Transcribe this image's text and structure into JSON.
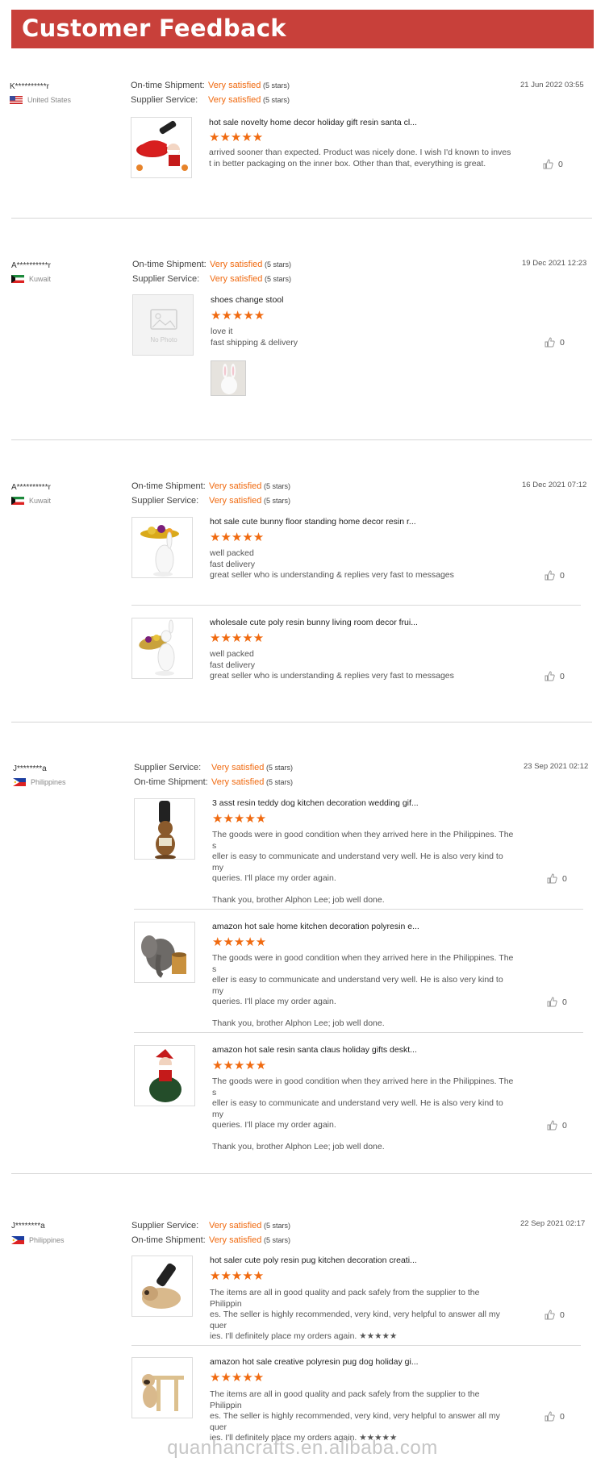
{
  "header": {
    "title": "Customer Feedback"
  },
  "like_count": "0",
  "reviews": [
    {
      "user": "K**********r",
      "country": "United States",
      "date": "21 Jun 2022 03:55",
      "ratings": [
        {
          "label": "On-time Shipment:",
          "value": "Very satisfied",
          "stars": "(5 stars)"
        },
        {
          "label": "Supplier Service:",
          "value": "Very satisfied",
          "stars": "(5 stars)"
        }
      ],
      "items": [
        {
          "title": "hot sale novelty home decor holiday gift resin santa cl...",
          "stars": "★★★★★",
          "lines": [
            "arrived sooner than expected.  Product was nicely done.  I wish I'd known to inves",
            "t in better packaging on the inner box.  Other than that, everything is great."
          ]
        }
      ]
    },
    {
      "user": "A**********r",
      "country": "Kuwait",
      "date": "19 Dec 2021 12:23",
      "ratings": [
        {
          "label": "On-time Shipment:",
          "value": "Very satisfied",
          "stars": "(5 stars)"
        },
        {
          "label": "Supplier Service:",
          "value": "Very satisfied",
          "stars": "(5 stars)"
        }
      ],
      "items": [
        {
          "title": "shoes change stool",
          "stars": "★★★★★",
          "no_photo": "No Photo",
          "lines": [
            "love it",
            "fast shipping & delivery"
          ]
        }
      ]
    },
    {
      "user": "A**********r",
      "country": "Kuwait",
      "date": "16 Dec 2021 07:12",
      "ratings": [
        {
          "label": "On-time Shipment:",
          "value": "Very satisfied",
          "stars": "(5 stars)"
        },
        {
          "label": "Supplier Service:",
          "value": "Very satisfied",
          "stars": "(5 stars)"
        }
      ],
      "items": [
        {
          "title": "hot sale cute bunny floor standing home decor resin r...",
          "stars": "★★★★★",
          "lines": [
            "well packed",
            "fast delivery",
            "great seller who is understanding & replies very fast to messages"
          ]
        },
        {
          "title": "wholesale cute poly resin bunny living room decor frui...",
          "stars": "★★★★★",
          "lines": [
            "well packed",
            "fast delivery",
            "great seller who is understanding & replies very fast to messages"
          ]
        }
      ]
    },
    {
      "user": "J********a",
      "country": "Philippines",
      "date": "23 Sep 2021 02:12",
      "ratings": [
        {
          "label": "Supplier Service:",
          "value": "Very satisfied",
          "stars": "(5 stars)"
        },
        {
          "label": "On-time Shipment:",
          "value": "Very satisfied",
          "stars": "(5 stars)"
        }
      ],
      "items": [
        {
          "title": "3 asst resin teddy dog kitchen decoration wedding gif...",
          "stars": "★★★★★",
          "lines": [
            "The goods were in good condition when they arrived here in the Philippines. The s",
            "eller is easy to communicate and understand very well. He is also very kind to my",
            "queries. I'll place my order again.",
            "",
            "Thank you, brother Alphon Lee; job well done."
          ]
        },
        {
          "title": "amazon hot sale home kitchen decoration polyresin e...",
          "stars": "★★★★★",
          "lines": [
            "The goods were in good condition when they arrived here in the Philippines. The s",
            "eller is easy to communicate and understand very well. He is also very kind to my",
            "queries. I'll place my order again.",
            "",
            "Thank you, brother Alphon Lee; job well done."
          ]
        },
        {
          "title": "amazon hot sale resin santa claus holiday gifts deskt...",
          "stars": "★★★★★",
          "lines": [
            "The goods were in good condition when they arrived here in the Philippines. The s",
            "eller is easy to communicate and understand very well. He is also very kind to my",
            "queries. I'll place my order again.",
            "",
            "Thank you, brother Alphon Lee; job well done."
          ]
        }
      ]
    },
    {
      "user": "J********a",
      "country": "Philippines",
      "date": "22 Sep 2021 02:17",
      "ratings": [
        {
          "label": "Supplier Service:",
          "value": "Very satisfied",
          "stars": "(5 stars)"
        },
        {
          "label": "On-time Shipment:",
          "value": "Very satisfied",
          "stars": "(5 stars)"
        }
      ],
      "items": [
        {
          "title": "hot saler cute poly resin pug kitchen decoration creati...",
          "stars": "★★★★★",
          "lines": [
            "The items are all in good quality and pack safely from the supplier to the Philippin",
            "es. The seller is highly recommended, very kind, very helpful to answer all my quer",
            "ies. I'll definitely place my orders again. ★★★★★"
          ]
        },
        {
          "title": "amazon hot sale creative polyresin pug dog holiday gi...",
          "stars": "★★★★★",
          "lines": [
            "The items are all in good quality and pack safely from the supplier to the Philippin",
            "es. The seller is highly recommended, very kind, very helpful to answer all my quer",
            "ies. I'll definitely place my orders again. ★★★★★"
          ]
        }
      ]
    }
  ],
  "footer": {
    "watermark": "quanhancrafts.en.alibaba.com"
  }
}
